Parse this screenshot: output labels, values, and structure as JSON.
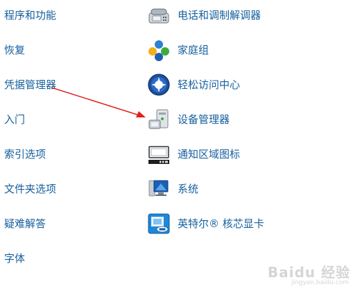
{
  "left_items": [
    {
      "label": "程序和功能"
    },
    {
      "label": "恢复"
    },
    {
      "label": "凭据管理器"
    },
    {
      "label": "入门"
    },
    {
      "label": "索引选项"
    },
    {
      "label": "文件夹选项"
    },
    {
      "label": "疑难解答"
    },
    {
      "label": "字体"
    }
  ],
  "right_items": [
    {
      "label": "电话和调制解调器",
      "icon": "phone-modem-icon"
    },
    {
      "label": "家庭组",
      "icon": "homegroup-icon"
    },
    {
      "label": "轻松访问中心",
      "icon": "ease-of-access-icon"
    },
    {
      "label": "设备管理器",
      "icon": "device-manager-icon"
    },
    {
      "label": "通知区域图标",
      "icon": "notification-area-icon"
    },
    {
      "label": "系统",
      "icon": "system-icon"
    },
    {
      "label": "英特尔® 核芯显卡",
      "icon": "intel-graphics-icon"
    }
  ],
  "annotation": {
    "color": "#e02020"
  },
  "watermark": {
    "logo": "Baidu 经验",
    "sub": "jingyan.baidu.com"
  }
}
